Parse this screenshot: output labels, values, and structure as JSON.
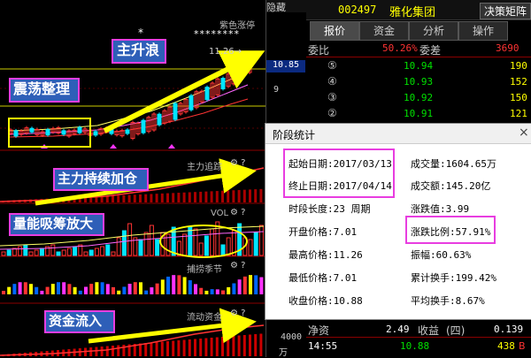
{
  "header": {
    "hidden_label": "隐藏",
    "stock_code": "002497",
    "stock_name": "雅化集团",
    "decision_btn": "决策矩阵"
  },
  "tabs": [
    {
      "label": "报价"
    },
    {
      "label": "资金"
    },
    {
      "label": "分析"
    },
    {
      "label": "操作"
    }
  ],
  "order_book": {
    "weibi_label": "委比",
    "weibi_value": "50.26%",
    "weicha_label": "委差",
    "weicha_value": "3690",
    "sells": [
      {
        "level": "⑤",
        "price": "10.94",
        "vol": "190"
      },
      {
        "level": "④",
        "price": "10.93",
        "vol": "152"
      },
      {
        "level": "③",
        "price": "10.92",
        "vol": "150"
      },
      {
        "level": "②",
        "price": "10.91",
        "vol": "121"
      }
    ]
  },
  "bottom_quote": {
    "jingzi_label": "净资",
    "jingzi_value": "2.49",
    "shouyi_label": "收益",
    "shouyi_value": "(四)",
    "shouyi_num": "0.139",
    "trade_time": "14:55",
    "trade_price": "10.88",
    "trade_vol": "438",
    "trade_side": "B"
  },
  "chart": {
    "top_star": "*",
    "stars": "********",
    "zise": "紫色涨停",
    "high_label": "11.26→",
    "price_tag": "10.85",
    "axis_9": "9",
    "axis_4000": "4000",
    "wan": "万",
    "ind1_title": "主力追踪",
    "ind2_title": "VOL",
    "ind3_title": "捕捞季节",
    "ind4_title": "流动资金",
    "notes": {
      "zhushenglang": "主升浪",
      "zhendang": "震荡整理",
      "jiacang": "主力持续加仓",
      "liangneng": "量能吸筹放大",
      "zijin": "资金流入"
    }
  },
  "dialog": {
    "title": "阶段统计",
    "close": "×",
    "start_date": "起始日期:2017/03/13",
    "end_date": "终止日期:2017/04/14",
    "period_len": "时段长度:23 周期",
    "open_price": "开盘价格:7.01",
    "high_price": "最高价格:11.26",
    "low_price": "最低价格:7.01",
    "close_price": "收盘价格:10.88",
    "volume": "成交量:1604.65万",
    "amount": "成交额:145.20亿",
    "change_amt": "涨跌值:3.99",
    "change_pct": "涨跌比例:57.91%",
    "amplitude": "振幅:60.63%",
    "cum_turnover": "累计换手:199.42%",
    "avg_turnover": "平均换手:8.67%"
  }
}
